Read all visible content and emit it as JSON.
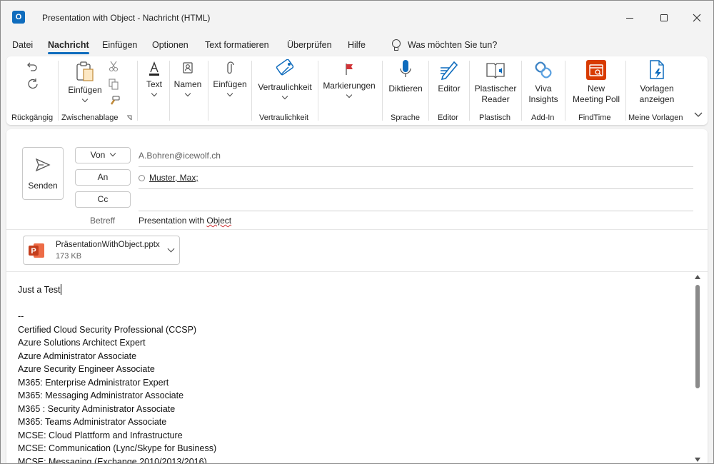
{
  "window": {
    "title": "Presentation with Object  -  Nachricht (HTML)",
    "app_icon_letter": "O"
  },
  "menu": {
    "tabs": [
      "Datei",
      "Nachricht",
      "Einfügen",
      "Optionen",
      "Text formatieren",
      "Überprüfen",
      "Hilfe"
    ],
    "active_tab": "Nachricht",
    "tell_me": "Was möchten Sie tun?"
  },
  "ribbon": {
    "undo_group_label": "Rückgängig",
    "clipboard": {
      "paste_label": "Einfügen",
      "group_label": "Zwischenablage"
    },
    "text_label": "Text",
    "names_label": "Namen",
    "insert_label": "Einfügen",
    "sensitivity": {
      "button_label": "Vertraulichkeit",
      "group_label": "Vertraulichkeit"
    },
    "tags_label": "Markierungen",
    "voice": {
      "button_label": "Diktieren",
      "group_label": "Sprache"
    },
    "editor": {
      "button_label": "Editor",
      "group_label": "Editor"
    },
    "immersive": {
      "button_label_1": "Plastischer",
      "button_label_2": "Reader",
      "group_label": "Plastisch"
    },
    "addin": {
      "button_label_1": "Viva",
      "button_label_2": "Insights",
      "group_label": "Add-In"
    },
    "findtime": {
      "button_label_1": "New",
      "button_label_2": "Meeting Poll",
      "group_label": "FindTime"
    },
    "templates": {
      "button_label_1": "Vorlagen",
      "button_label_2": "anzeigen",
      "group_label": "Meine Vorlagen"
    }
  },
  "compose": {
    "send_label": "Senden",
    "from_label": "Von",
    "from_value": "A.Bohren@icewolf.ch",
    "to_label": "An",
    "to_value": "Muster, Max;",
    "cc_label": "Cc",
    "subject_label": "Betreff",
    "subject_value_plain": "Presentation with ",
    "subject_value_flagged": "Object"
  },
  "attachment": {
    "name": "PräsentationWithObject.pptx",
    "size": "173 KB",
    "icon_letter": "P"
  },
  "body": {
    "first_line": "Just a Test",
    "signature_sep": "--",
    "lines": [
      "Certified Cloud Security Professional (CCSP)",
      "Azure Solutions Architect Expert",
      "Azure Administrator Associate",
      "Azure Security Engineer Associate",
      "M365: Enterprise Administrator Expert",
      "M365: Messaging Administrator Associate",
      "M365 : Security Administrator Associate",
      "M365: Teams Administrator Associate",
      "MCSE: Cloud Plattform and Infrastructure",
      "MCSE: Communication (Lync/Skype for Business)",
      "MCSE: Messaging (Exchange 2010/2013/2016)"
    ]
  },
  "colors": {
    "accent": "#0f6cbd",
    "powerpoint": "#c43e1c",
    "findtime": "#d83b01",
    "spellcheck": "#d13438"
  }
}
